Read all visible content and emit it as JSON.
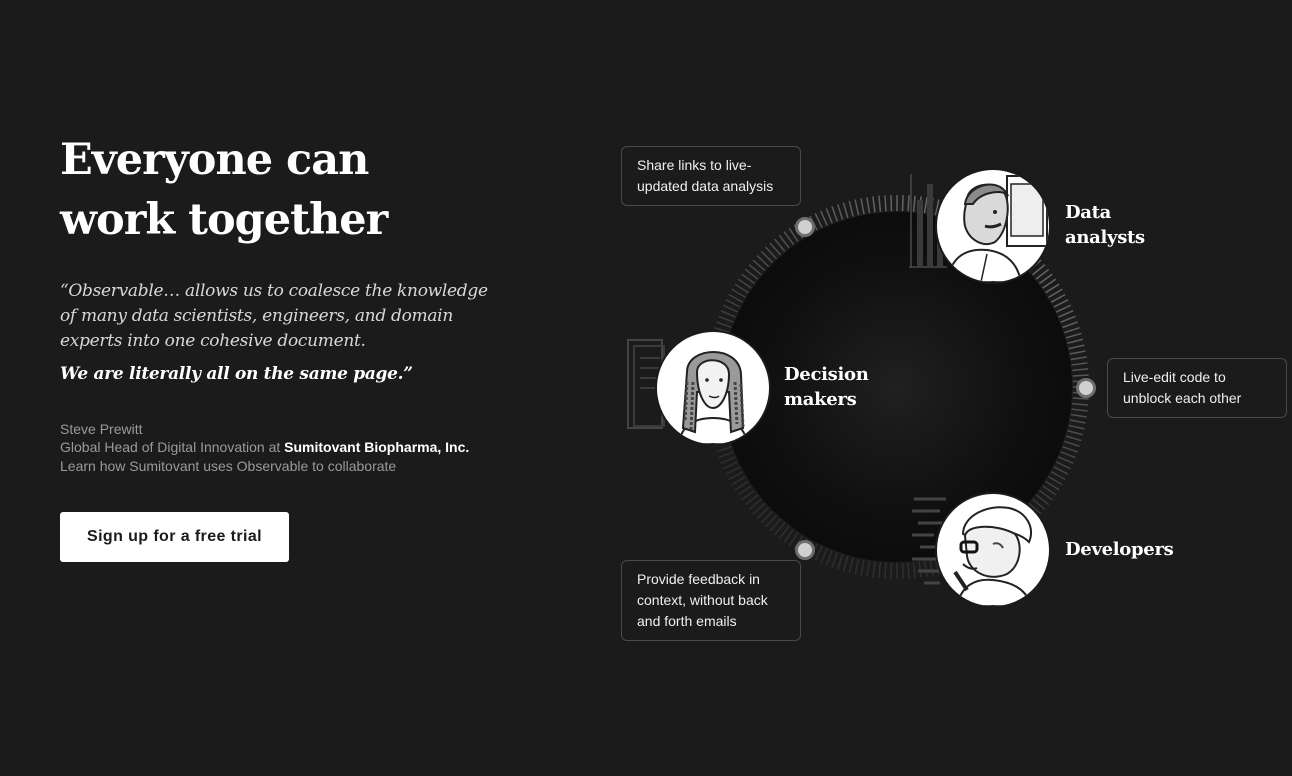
{
  "hero": {
    "headline_line1": "Everyone can",
    "headline_line2": "work together",
    "quote": "“Observable… allows us to coalesce the knowledge of many data scientists, engineers, and domain experts into one cohesive document.",
    "quote_emphasis": "We are literally all on the same page.”",
    "attribution": {
      "name": "Steve Prewitt",
      "role_prefix": "Global Head of Digital Innovation at",
      "company": "Sumitovant Biopharma, Inc.",
      "learn_more": "Learn how Sumitovant uses Observable to collaborate"
    },
    "cta_label": "Sign up for a free trial"
  },
  "diagram": {
    "roles": {
      "data_analysts": "Data analysts",
      "decision_makers": "Decision makers",
      "developers": "Developers"
    },
    "callouts": {
      "share_links": "Share links to live-updated data analysis",
      "live_edit": "Live-edit code to unblock each other",
      "feedback": "Provide feedback in context, without back and forth emails"
    }
  },
  "colors": {
    "background": "#1b1b1b",
    "text_primary": "#ffffff",
    "text_muted": "#9a9a9a",
    "button_bg": "#ffffff"
  }
}
